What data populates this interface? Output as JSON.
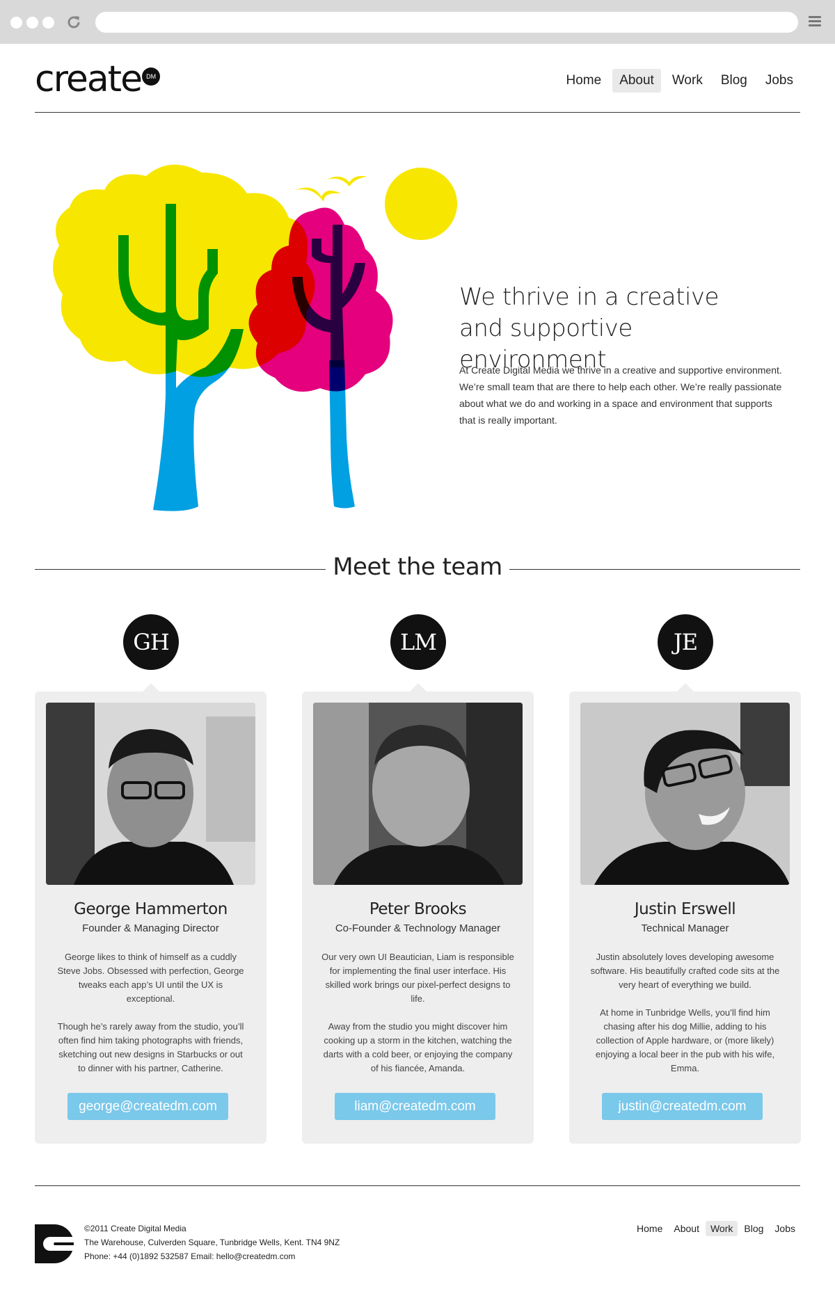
{
  "logo": {
    "word": "create",
    "badge": "DM"
  },
  "nav": {
    "items": [
      {
        "label": "Home"
      },
      {
        "label": "About",
        "active": true
      },
      {
        "label": "Work"
      },
      {
        "label": "Blog"
      },
      {
        "label": "Jobs"
      }
    ]
  },
  "hero": {
    "title": "We thrive in a creative and supportive environment",
    "body": "At Create Digital Media we thrive in a creative and supportive environment. We’re small team that are there to help each other. We’re really passionate about what we do and working in a space and environment that supports that is really important."
  },
  "team": {
    "heading": "Meet the team",
    "members": [
      {
        "initials": "GH",
        "name": "George Hammerton",
        "role": "Founder & Managing Director",
        "bio1": "George likes to think of himself as a cuddly Steve Jobs. Obsessed with perfection, George tweaks each app’s UI until the UX is exceptional.",
        "bio2": "Though he’s rarely away from the studio, you’ll often find him taking photographs with friends, sketching out new designs in Starbucks or out to dinner with his partner, Catherine.",
        "email": "george@createdm.com"
      },
      {
        "initials": "LM",
        "name": "Peter Brooks",
        "role": "Co-Founder & Technology Manager",
        "bio1": "Our very own UI Beautician, Liam is responsible for implementing the final user interface. His skilled work brings our pixel-perfect designs to life.",
        "bio2": "Away from the studio you might discover him cooking up a storm in the kitchen, watching the darts with a cold beer, or enjoying the company of his fiancée, Amanda.",
        "email": "liam@createdm.com"
      },
      {
        "initials": "JE",
        "name": "Justin Erswell",
        "role": "Technical Manager",
        "bio1": "Justin absolutely loves developing awesome software. His beautifully crafted code sits at the very heart of everything we build.",
        "bio2": "At home in Tunbridge Wells, you’ll find him chasing after his dog Millie, adding to his collection of Apple hardware, or (more likely) enjoying a local beer in the pub with his wife, Emma.",
        "email": "justin@createdm.com"
      }
    ]
  },
  "footer": {
    "copyright": "©2011 Create Digital Media",
    "address": "The Warehouse, Culverden Square, Tunbridge Wells, Kent. TN4 9NZ",
    "contact": "Phone: +44 (0)1892 532587   Email: hello@createdm.com",
    "nav": [
      {
        "label": "Home"
      },
      {
        "label": "About"
      },
      {
        "label": "Work",
        "active": true
      },
      {
        "label": "Blog"
      },
      {
        "label": "Jobs"
      }
    ]
  },
  "colors": {
    "accent": "#7ac8ea",
    "card": "#eeeeee",
    "yellow": "#f7e600",
    "magenta": "#e5007d",
    "cyan": "#00a0e3"
  }
}
